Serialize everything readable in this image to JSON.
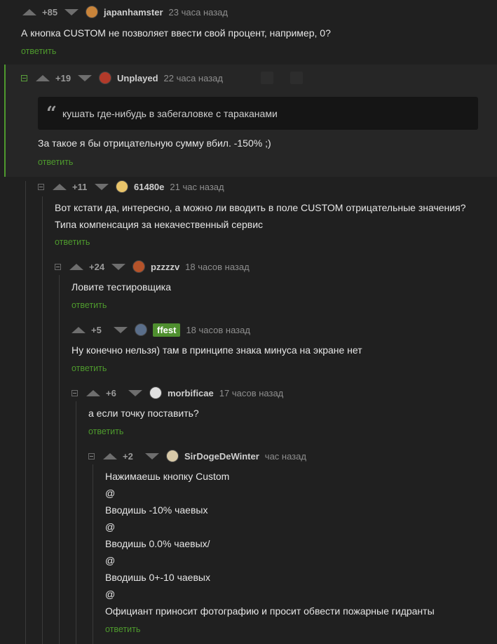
{
  "comments": [
    {
      "rating": "+85",
      "nick": "japanhamster",
      "time": "23 часа назад",
      "lines": [
        "А кнопка CUSTOM не позволяет ввести свой процент, например, 0?"
      ],
      "reply": "ответить",
      "avatar_color": "#c9843a"
    },
    {
      "rating": "+19",
      "nick": "Unplayed",
      "time": "22 часа назад",
      "quote": "кушать где-нибудь в забегаловке с тараканами",
      "lines": [
        "За такое я бы отрицательную сумму вбил. -150% ;)"
      ],
      "reply": "ответить",
      "avatar_color": "#b23a2a"
    },
    {
      "rating": "+11",
      "nick": "61480e",
      "time": "21 час назад",
      "lines": [
        "Вот кстати да, интересно, а можно ли вводить в поле CUSTOM отрицательные значения?",
        "Типа компенсация за некачественный сервис"
      ],
      "reply": "ответить",
      "avatar_color": "#e9c46a"
    },
    {
      "rating": "+24",
      "nick": "pzzzzv",
      "time": "18 часов назад",
      "lines": [
        "Ловите тестировщика"
      ],
      "reply": "ответить",
      "avatar_color": "#b5532a"
    },
    {
      "rating": "+5",
      "nick": "ffest",
      "time": "18 часов назад",
      "lines": [
        "Ну конечно нельзя) там в принципе знака минуса на экране нет"
      ],
      "reply": "ответить",
      "avatar_color": "#5a6e8a"
    },
    {
      "rating": "+6",
      "nick": "morbificae",
      "time": "17 часов назад",
      "lines": [
        "а если точку поставить?"
      ],
      "reply": "ответить",
      "avatar_color": "#e0e0e0"
    },
    {
      "rating": "+2",
      "nick": "SirDogeDeWinter",
      "time": "час назад",
      "lines": [
        "Нажимаешь кнопку Custom",
        "@",
        "Вводишь -10% чаевых",
        "@",
        "Вводишь 0.0% чаевых/",
        "@",
        "Вводишь 0+-10 чаевых",
        "@",
        "Официант приносит фотографию и просит обвести пожарные гидранты"
      ],
      "reply": "ответить",
      "avatar_color": "#d8c9a8"
    }
  ],
  "colors": {
    "accent_green": "#4e9a2d",
    "background": "#202020",
    "badge": "#4f8f2f"
  }
}
